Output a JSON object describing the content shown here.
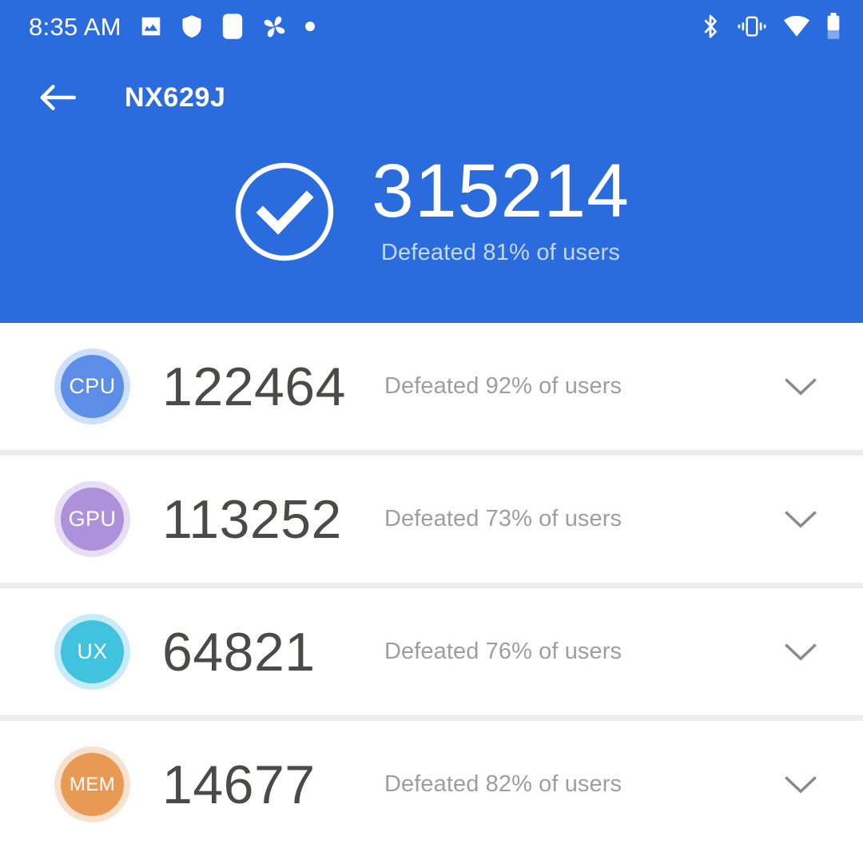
{
  "statusbar": {
    "clock": "8:35 AM",
    "left_icons": [
      {
        "name": "photo-icon"
      },
      {
        "name": "shield-icon"
      },
      {
        "name": "rounded-square-icon"
      },
      {
        "name": "pinwheel-icon"
      },
      {
        "name": "dot-icon"
      }
    ],
    "right_icons": [
      {
        "name": "bluetooth-icon"
      },
      {
        "name": "vibrate-icon"
      },
      {
        "name": "wifi-icon"
      },
      {
        "name": "battery-icon"
      }
    ]
  },
  "appbar": {
    "back_label": "Back",
    "title": "NX629J"
  },
  "total": {
    "score": "315214",
    "subtitle": "Defeated 81% of users",
    "status_icon": "check-circle-icon"
  },
  "colors": {
    "header_blue": "#2a6cde",
    "total_sub": "#c5d8f4",
    "row_score": "#4a4a47",
    "row_sub": "#9e9e9e",
    "divider": "#eceded",
    "cpu": "#5c8ee8",
    "cpu_ring": "#cfe0fb",
    "gpu": "#ad92db",
    "gpu_ring": "#e7def5",
    "ux": "#41c3e0",
    "ux_ring": "#c8ecf7",
    "mem": "#e89a55",
    "mem_ring": "#f7e2cf"
  },
  "rows": [
    {
      "badge": "CPU",
      "score": "122464",
      "subtitle": "Defeated 92% of users",
      "badge_color": "#5c8ee8",
      "ring_color": "#cfe0fb",
      "expand_icon": "chevron-down-icon"
    },
    {
      "badge": "GPU",
      "score": "113252",
      "subtitle": "Defeated 73% of users",
      "badge_color": "#ad92db",
      "ring_color": "#e7def5",
      "expand_icon": "chevron-down-icon"
    },
    {
      "badge": "UX",
      "score": "64821",
      "subtitle": "Defeated 76% of users",
      "badge_color": "#41c3e0",
      "ring_color": "#c8ecf7",
      "expand_icon": "chevron-down-icon"
    },
    {
      "badge": "MEM",
      "score": "14677",
      "subtitle": "Defeated 82% of users",
      "badge_color": "#e89a55",
      "ring_color": "#f7e2cf",
      "expand_icon": "chevron-down-icon"
    }
  ]
}
